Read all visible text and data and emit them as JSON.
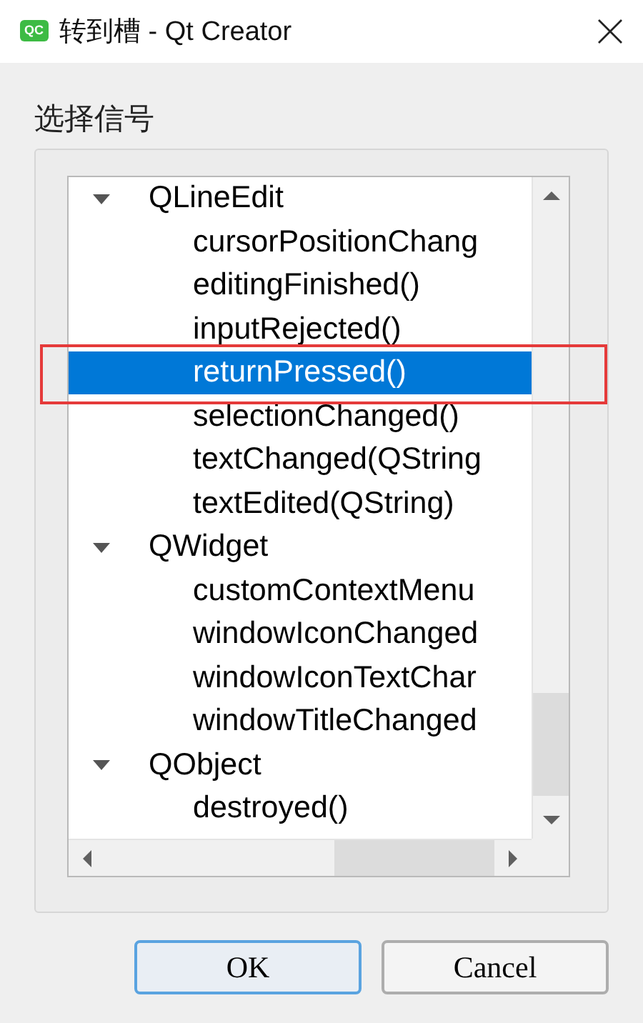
{
  "window": {
    "title": "转到槽 - Qt Creator",
    "app_icon": "QC"
  },
  "group_label": "选择信号",
  "tree": [
    {
      "label": "QLineEdit",
      "expanded": true,
      "children": [
        {
          "label": "cursorPositionChang",
          "selected": false
        },
        {
          "label": "editingFinished()",
          "selected": false
        },
        {
          "label": "inputRejected()",
          "selected": false
        },
        {
          "label": "returnPressed()",
          "selected": true
        },
        {
          "label": "selectionChanged()",
          "selected": false
        },
        {
          "label": "textChanged(QString",
          "selected": false
        },
        {
          "label": "textEdited(QString)",
          "selected": false
        }
      ]
    },
    {
      "label": "QWidget",
      "expanded": true,
      "children": [
        {
          "label": "customContextMenu",
          "selected": false
        },
        {
          "label": "windowIconChanged",
          "selected": false
        },
        {
          "label": "windowIconTextChar",
          "selected": false
        },
        {
          "label": "windowTitleChanged",
          "selected": false
        }
      ]
    },
    {
      "label": "QObject",
      "expanded": true,
      "children": [
        {
          "label": "destroyed()",
          "selected": false
        }
      ]
    }
  ],
  "buttons": [
    {
      "label": "OK",
      "default": true
    },
    {
      "label": "Cancel",
      "default": false
    }
  ]
}
